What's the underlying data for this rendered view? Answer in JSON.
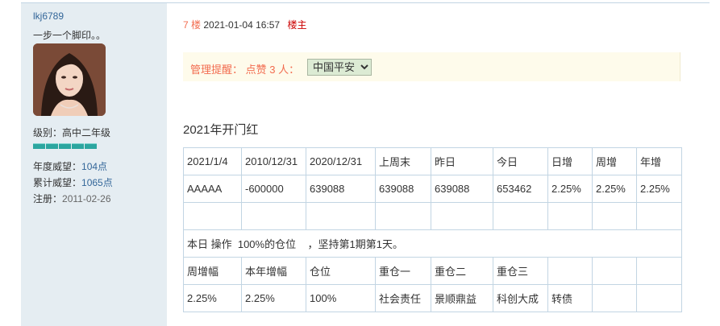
{
  "user": {
    "name": "lkj6789",
    "motto": "一步一个脚印。。",
    "level_label": "级别：",
    "level": "高中二年级",
    "stats": [
      {
        "label": "年度威望：",
        "value": "104点"
      },
      {
        "label": "累计威望：",
        "value": "1065点"
      },
      {
        "label": "注册：",
        "value": "2011-02-26"
      }
    ]
  },
  "post": {
    "floor": "7 楼",
    "datetime": "2021-01-04 16:57",
    "owner_tag": "楼主",
    "notice_text": "管理提醒： 点赞 3 人：",
    "notice_select": "中国平安",
    "title": "2021年开门红"
  },
  "table": {
    "header": [
      "2021/1/4",
      "2010/12/31",
      "2020/12/31",
      "上周末",
      "昨日",
      "今日",
      "日增",
      "周增",
      "年增"
    ],
    "row1": [
      "AAAAA",
      "-600000",
      "639088",
      "639088",
      "639088",
      "653462",
      "2.25%",
      "2.25%",
      "2.25%"
    ],
    "row2": [
      "",
      "",
      "",
      "",
      "",
      "",
      "",
      "",
      ""
    ],
    "op_text": "本日 操作  100%的仓位    ，坚持第1期第1天。",
    "header2": [
      "周增幅",
      "本年增幅",
      "仓位",
      "重仓一",
      "重仓二",
      "重仓三",
      "",
      "",
      ""
    ],
    "row3": [
      "2.25%",
      "2.25%",
      "100%",
      "社会责任",
      "景顺鼎益",
      "科创大成",
      "转债",
      "",
      ""
    ]
  },
  "colors": {
    "sidebar_bg": "#e5edf2",
    "link_blue": "#336699",
    "floor_orange": "#f26c4f",
    "owner_red": "#cc0000",
    "level_bar": "#2ca6a0",
    "table_border": "#c2d5e3"
  }
}
